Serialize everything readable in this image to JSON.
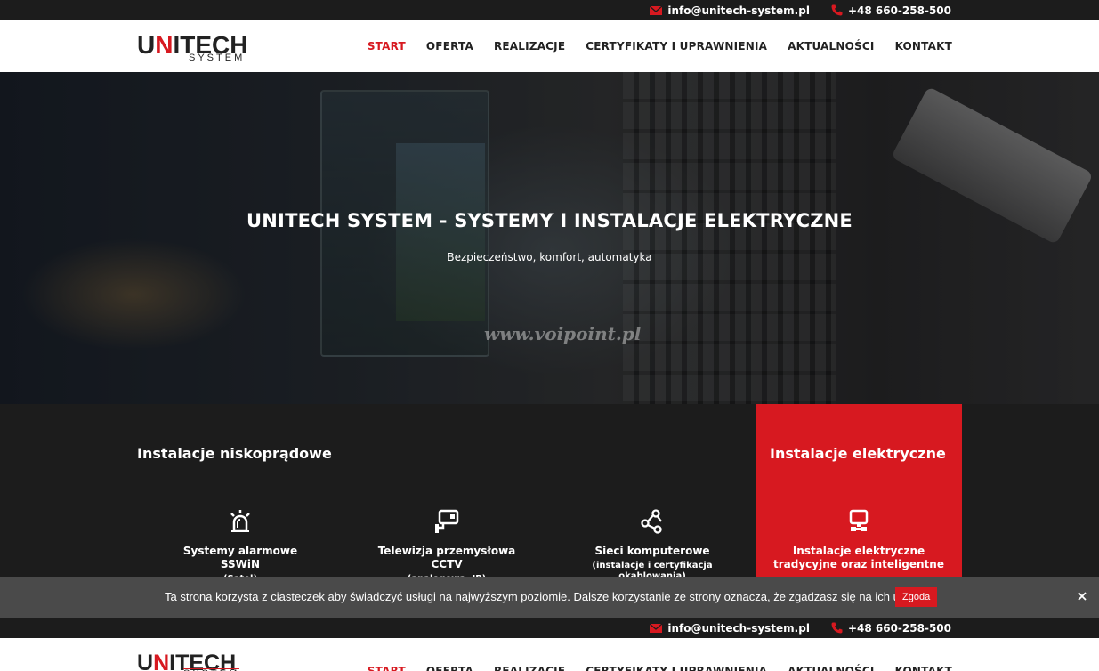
{
  "topbar": {
    "email": "info@unitech-system.pl",
    "phone": "+48 660-258-500"
  },
  "logo": {
    "main_a": "U",
    "main_b": "N",
    "main_c": "ITECH",
    "sub": "SYSTEM"
  },
  "nav": {
    "items": [
      {
        "label": "START",
        "active": true
      },
      {
        "label": "OFERTA"
      },
      {
        "label": "REALIZACJE"
      },
      {
        "label": "CERTYFIKATY I UPRAWNIENIA"
      },
      {
        "label": "AKTUALNOŚCI"
      },
      {
        "label": "KONTAKT"
      }
    ]
  },
  "hero": {
    "title": "UNITECH SYSTEM - SYSTEMY I INSTALACJE ELEKTRYCZNE",
    "subtitle": "Bezpieczeństwo, komfort, automatyka",
    "watermark": "www.voipoint.pl"
  },
  "services": {
    "low_voltage_heading": "Instalacje niskoprądowe",
    "electrical_heading": "Instalacje elektryczne",
    "items": [
      {
        "name": "Systemy alarmowe SSWiN",
        "desc": "(Satel)",
        "icon": "alarm-siren-icon"
      },
      {
        "name": "Telewizja przemysłowa CCTV",
        "desc": "(analogowa, IP)",
        "icon": "cctv-camera-icon"
      },
      {
        "name": "Sieci komputerowe",
        "desc": "(instalacje i certyfikacja okablowania)",
        "icon": "network-icon"
      },
      {
        "name": "Instalacje elektryczne tradycyjne oraz inteligentne",
        "desc": "",
        "icon": "monitor-plug-icon"
      }
    ]
  },
  "cookie": {
    "message": "Ta strona korzysta z ciasteczek aby świadczyć usługi na najwyższym poziomie. Dalsze korzystanie ze strony oznacza, że zgadzasz się na ich użycie.",
    "agree_label": "Zgoda"
  },
  "colors": {
    "accent": "#d71920",
    "dark": "#1c1c1c",
    "cookie_bg": "#4a4a4a"
  }
}
